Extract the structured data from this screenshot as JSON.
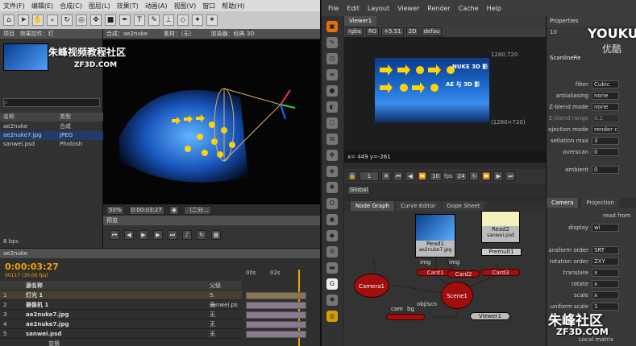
{
  "ae": {
    "menu": [
      "文件(F)",
      "编辑(E)",
      "合成(C)",
      "图层(L)",
      "效果(T)",
      "动画(A)",
      "视图(V)",
      "窗口",
      "帮助(H)"
    ],
    "project": {
      "tab": "项目",
      "tab2": "效果控件：灯",
      "search_placeholder": "ρ",
      "col_name": "名称",
      "col_type": "类型",
      "rows": [
        {
          "name": "ae2nuke",
          "type": "合成"
        },
        {
          "name": "ae2nuke7.jpg",
          "type": "JPEG"
        },
        {
          "name": "sanwei.psd",
          "type": "Photosh"
        }
      ],
      "bpc": "8 bpc"
    },
    "comp": {
      "tab": "合成：ae2nuke",
      "tab2": "素材：（无）",
      "renderer": "渲染器：经典 3D",
      "zoom": "50%",
      "timecode": "0:00:03:27",
      "view": "（二分..."
    },
    "preview": {
      "tab": "预览"
    },
    "timeline": {
      "tab": "ae2nuke",
      "timecode": "0:00:03:27",
      "frame_info": "00117 (30.00 fps)",
      "col_source": "源名称",
      "col_parent": "父级",
      "layers": [
        {
          "num": "1",
          "name": "灯光 1",
          "parent": "5. sanwei.ps"
        },
        {
          "num": "2",
          "name": "摄像机 1",
          "parent": "无"
        },
        {
          "num": "3",
          "name": "ae2nuke7.jpg",
          "parent": "无"
        },
        {
          "num": "4",
          "name": "ae2nuke7.jpg",
          "parent": "无"
        },
        {
          "num": "5",
          "name": "sanwei.psd",
          "parent": "无"
        }
      ],
      "sublayer": "变换",
      "time_00": "00s",
      "time_02": "02s"
    }
  },
  "nuke": {
    "menu": [
      "File",
      "Edit",
      "Layout",
      "Viewer",
      "Render",
      "Cache",
      "Help"
    ],
    "viewer_tab": "Viewer1",
    "viewer_controls": [
      "rgba",
      "RG",
      "+5.51",
      "2D",
      "defau"
    ],
    "image_size": "1280,720",
    "image_size_label": "(1280×720)",
    "coords": "x= 449 y=-261",
    "image_text_1": "NUKE 3D 影",
    "image_text_2": "AE 与 3D 影",
    "frame": "10",
    "fps_label": "fps",
    "fps": "24",
    "global": "Global",
    "node_tabs": [
      "Node Graph",
      "Curve Editor",
      "Dope Sheet"
    ],
    "nodes": {
      "read1": "Read1",
      "read1_file": "ae2nuke7.jpg",
      "read2": "Read2",
      "read2_file": "sanwei.psd",
      "premult": "Premult1",
      "card1": "Card1",
      "card2": "Card2",
      "card3": "Card3",
      "camera": "Camera1",
      "scene": "Scene1",
      "viewer": "Viewer1",
      "img": "img",
      "img2": "img",
      "cam": "cam",
      "bg": "bg",
      "obj": "obj/scn"
    },
    "props": {
      "tab": "Properties",
      "count": "10",
      "node": "ScanlineRe",
      "rows": [
        {
          "label": "filter",
          "value": "Cubic"
        },
        {
          "label": "antialiasing",
          "value": "none"
        },
        {
          "label": "Z-blend mode",
          "value": "none"
        },
        {
          "label": "Z-blend range",
          "value": "0.1"
        },
        {
          "label": "ojection mode",
          "value": "render c"
        },
        {
          "label": "sellation max",
          "value": "3"
        },
        {
          "label": "overscan",
          "value": "0"
        }
      ],
      "ambient_label": "ambient",
      "ambient_value": "0",
      "camera_tab": "Camera",
      "projection_tab": "Projection",
      "read_from": "read from",
      "display_label": "display",
      "display_value": "wi",
      "transform_rows": [
        {
          "label": "ansform order",
          "value": "SRT"
        },
        {
          "label": "rotation order",
          "value": "ZXY"
        },
        {
          "label": "translate",
          "value": "x"
        },
        {
          "label": "rotate",
          "value": "x"
        },
        {
          "label": "scale",
          "value": "x"
        },
        {
          "label": "uniform scale",
          "value": "1"
        }
      ],
      "local_matrix": "Local matrix"
    }
  },
  "watermarks": {
    "zf_top": "朱峰视频教程社区",
    "zf_top2": "ZF3D.COM",
    "youku": "YOUKU",
    "youku_cn": "优酷",
    "zf_bottom": "朱峰社区",
    "zf_bottom2": "ZF3D.COM"
  }
}
